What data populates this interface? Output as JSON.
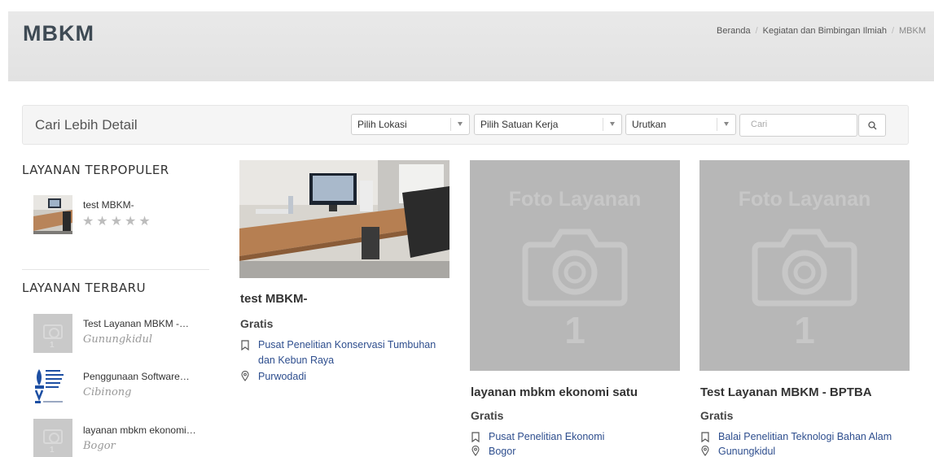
{
  "page": {
    "title": "MBKM"
  },
  "breadcrumb": {
    "home": "Beranda",
    "parent": "Kegiatan dan Bimbingan Ilmiah",
    "current": "MBKM"
  },
  "search": {
    "label": "Cari Lebih Detail",
    "location": "Pilih Lokasi",
    "unit": "Pilih Satuan Kerja",
    "sort": "Urutkan",
    "placeholder": "Cari"
  },
  "sidebar": {
    "popular_heading": "LAYANAN TERPOPULER",
    "popular": [
      {
        "title": "test MBKM-",
        "stars": "★★★★★"
      }
    ],
    "latest_heading": "LAYANAN TERBARU",
    "latest": [
      {
        "title": "Test Layanan MBKM -…",
        "location": "Gunungkidul",
        "thumb_number": "1"
      },
      {
        "title": "Penggunaan Software…",
        "location": "Cibinong"
      },
      {
        "title": "layanan mbkm ekonomi…",
        "location": "Bogor",
        "thumb_number": "1"
      }
    ]
  },
  "cards": [
    {
      "title": "test MBKM-",
      "price": "Gratis",
      "unit": "Pusat Penelitian Konservasi Tumbuhan",
      "unit_line2": "dan Kebun Raya",
      "location": "Purwodadi"
    },
    {
      "placeholder_text": "Foto Layanan",
      "placeholder_number": "1",
      "title": "layanan mbkm ekonomi satu",
      "price": "Gratis",
      "unit": "Pusat Penelitian Ekonomi",
      "location": "Bogor"
    },
    {
      "placeholder_text": "Foto Layanan",
      "placeholder_number": "1",
      "title": "Test Layanan MBKM - BPTBA",
      "price": "Gratis",
      "unit": "Balai Penelitian Teknologi Bahan Alam",
      "location": "Gunungkidul"
    }
  ],
  "colors": {
    "link": "#2e4e8e",
    "placeholder_bg": "#b7b7b7",
    "header_bg": "#e6e6e6"
  }
}
